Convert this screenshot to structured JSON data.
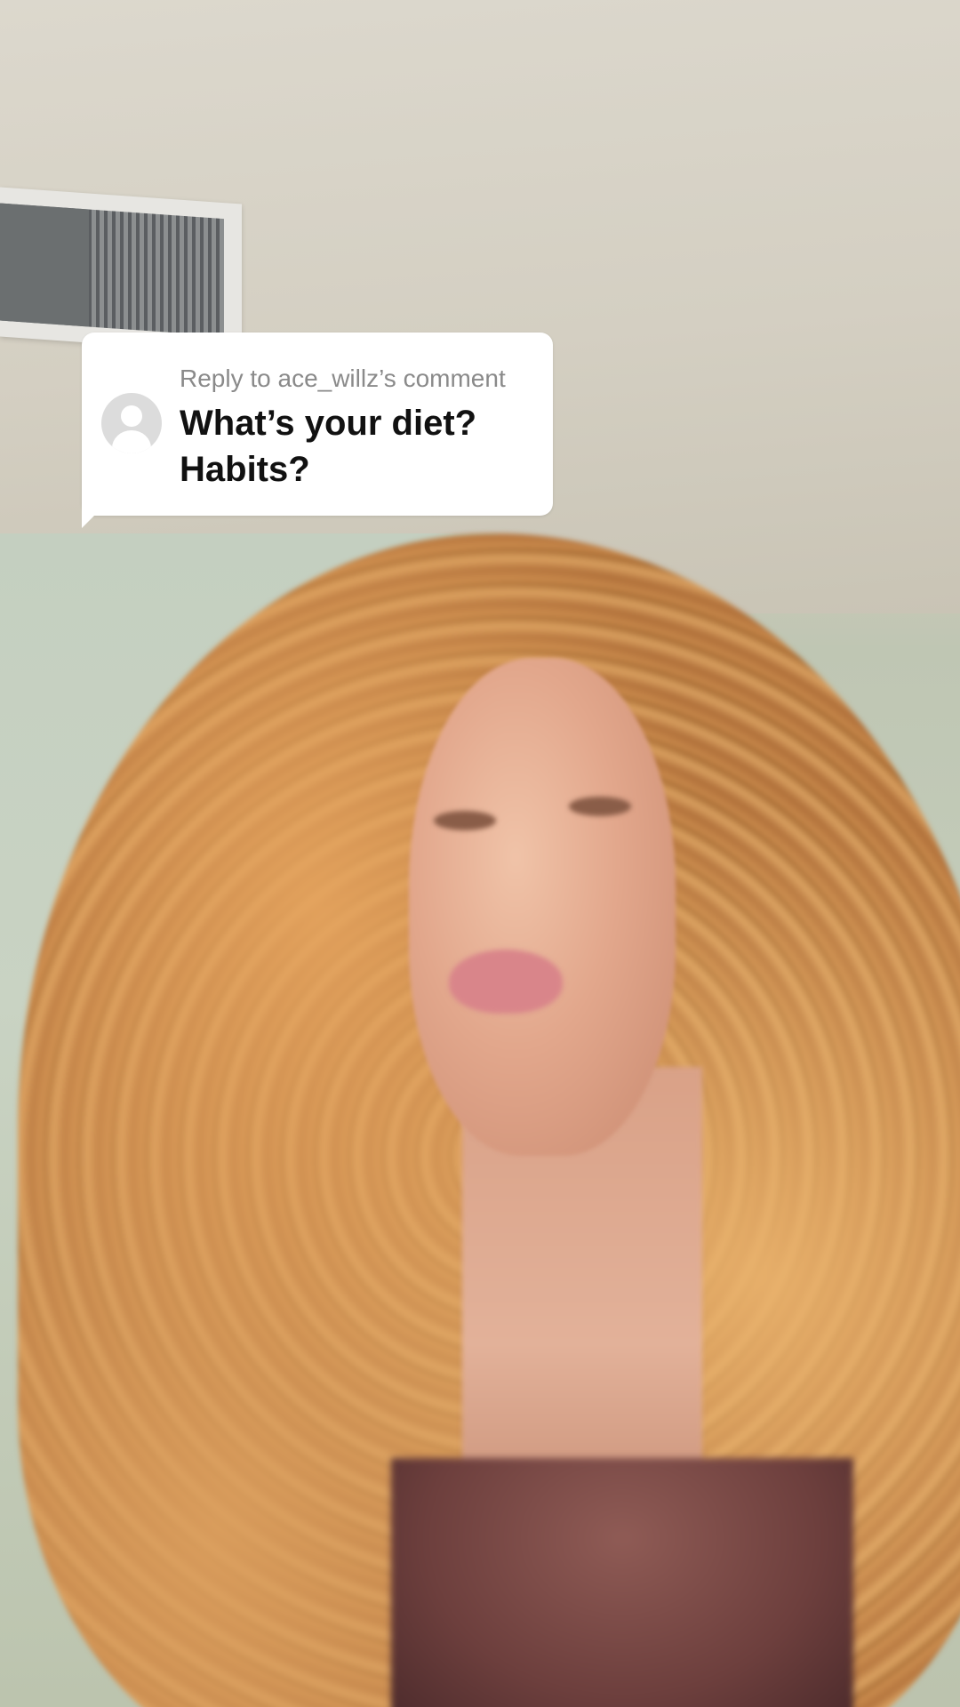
{
  "reply_sticker": {
    "label": "Reply to ace_willz’s comment",
    "comment_line1": "What’s your diet?",
    "comment_line2": "Habits?",
    "avatar_icon": "default-user-avatar-icon"
  },
  "colors": {
    "sticker_background": "#ffffff",
    "label_color": "#8a8a8a",
    "comment_color": "#111111",
    "avatar_background": "#dcdcdc"
  }
}
